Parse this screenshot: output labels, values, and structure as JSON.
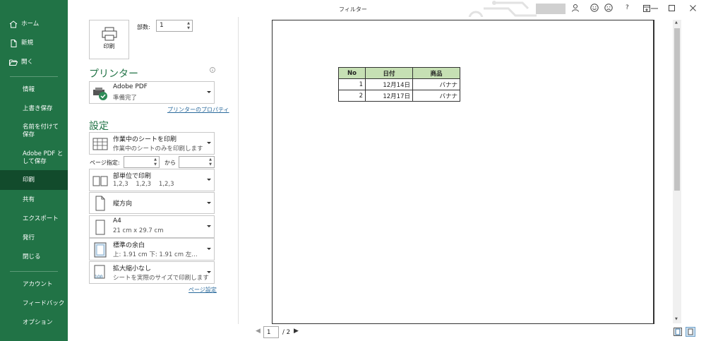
{
  "window": {
    "title": "フィルター",
    "help": "?"
  },
  "sidebar": {
    "top_items": [
      {
        "label": "ホーム",
        "icon": "home-icon"
      },
      {
        "label": "新規",
        "icon": "new-doc-icon"
      },
      {
        "label": "開く",
        "icon": "folder-open-icon"
      }
    ],
    "items": [
      {
        "label": "情報"
      },
      {
        "label": "上書き保存"
      },
      {
        "label": "名前を付けて保存"
      },
      {
        "label": "Adobe PDF として保存"
      },
      {
        "label": "印刷",
        "active": true
      },
      {
        "label": "共有"
      },
      {
        "label": "エクスポート"
      },
      {
        "label": "発行"
      },
      {
        "label": "閉じる"
      }
    ],
    "bottom_items": [
      {
        "label": "アカウント"
      },
      {
        "label": "フィードバック"
      },
      {
        "label": "オプション"
      }
    ]
  },
  "print": {
    "button_label": "印刷",
    "copies_label": "部数:",
    "copies_value": "1"
  },
  "printer": {
    "heading": "プリンター",
    "name": "Adobe PDF",
    "status": "準備完了",
    "properties_link": "プリンターのプロパティ"
  },
  "settings": {
    "heading": "設定",
    "scope": {
      "title": "作業中のシートを印刷",
      "subtitle": "作業中のシートのみを印刷します"
    },
    "pages": {
      "label": "ページ指定:",
      "from": "",
      "to_label": "から",
      "to": ""
    },
    "collate": {
      "title": "部単位で印刷",
      "subtitle": "1,2,3    1,2,3    1,2,3"
    },
    "orientation": {
      "title": "縦方向"
    },
    "paper": {
      "title": "A4",
      "subtitle": "21 cm x 29.7 cm"
    },
    "margins": {
      "title": "標準の余白",
      "subtitle": "上: 1.91 cm 下: 1.91 cm 左…"
    },
    "scaling": {
      "title": "拡大縮小なし",
      "subtitle": "シートを実際のサイズで印刷します",
      "icon_text": "100"
    },
    "page_setup_link": "ページ設定"
  },
  "preview": {
    "table": {
      "headers": [
        "No",
        "日付",
        "商品"
      ],
      "rows": [
        [
          "1",
          "12月14日",
          "バナナ"
        ],
        [
          "2",
          "12月17日",
          "バナナ"
        ]
      ]
    },
    "current_page": "1",
    "total_pages": "/ 2"
  },
  "colors": {
    "accent": "#217346",
    "header_fill": "#c6e0b4"
  }
}
